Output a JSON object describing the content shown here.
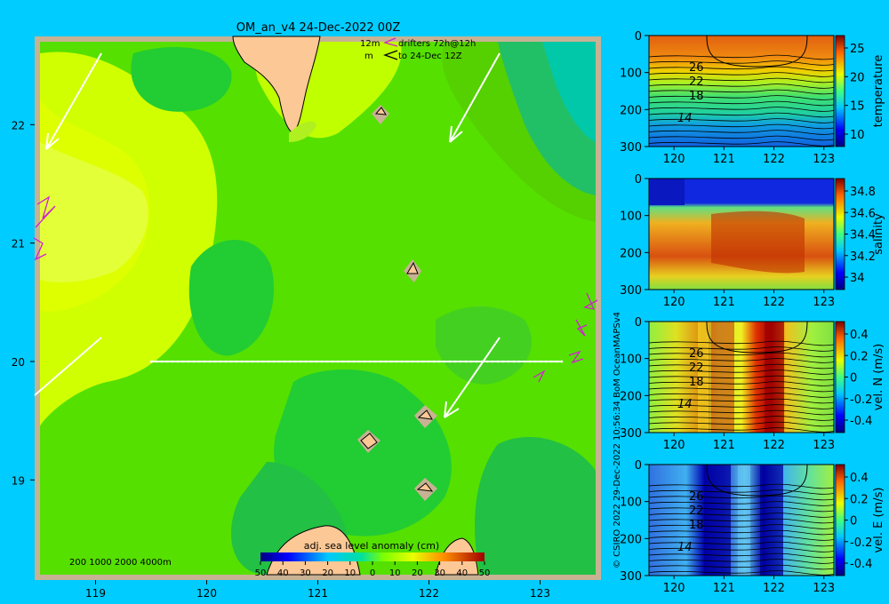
{
  "colors": {
    "background": "#00ccff",
    "frame": "#c8b294",
    "land": "#fcc896",
    "drifter": "#d020d0",
    "section_line": "#ffffff"
  },
  "chart_data": [
    {
      "type": "heatmap",
      "panel": "map",
      "title": "OM_an_v4  24-Dec-2022 00Z",
      "x_ticks": [
        "119",
        "120",
        "121",
        "122",
        "123"
      ],
      "y_ticks": [
        "22",
        "21",
        "20",
        "19"
      ],
      "xlim": [
        118.5,
        123.5
      ],
      "ylim": [
        18.2,
        22.7
      ],
      "legend": {
        "scale_label": "12m",
        "unit_label": "m",
        "drifters_label": "drifters 72h@12h",
        "drifters_date": "to 24-Dec 12Z"
      },
      "depth_legend": "200  1000  2000  4000m",
      "colorbar": {
        "label": "adj. sea level anomaly (cm)",
        "ticks": [
          "50",
          "40",
          "30",
          "20",
          "10",
          "0",
          "10",
          "20",
          "30",
          "40",
          "50"
        ],
        "range": [
          -50,
          50
        ]
      },
      "section_line": {
        "lon": [
          119.5,
          123.2
        ],
        "lat": [
          20.0,
          20.0
        ]
      },
      "current_arrows": [
        {
          "from": [
            118.9,
            22.55
          ],
          "to": [
            118.6,
            21.7
          ]
        },
        {
          "from": [
            122.6,
            22.55
          ],
          "to": [
            122.2,
            21.8
          ]
        },
        {
          "from": [
            119.1,
            20.2
          ],
          "to": [
            118.5,
            19.7
          ]
        },
        {
          "from": [
            122.6,
            20.2
          ],
          "to": [
            122.1,
            19.5
          ]
        }
      ]
    },
    {
      "type": "heatmap",
      "panel": "temperature",
      "x_ticks": [
        "120",
        "121",
        "122",
        "123"
      ],
      "y_ticks": [
        "0",
        "100",
        "200",
        "300"
      ],
      "colorbar_label": "temperature",
      "colorbar_ticks": [
        "25",
        "20",
        "15",
        "10"
      ],
      "contour_labels": [
        "26",
        "22",
        "18",
        "14"
      ]
    },
    {
      "type": "heatmap",
      "panel": "salinity",
      "x_ticks": [
        "120",
        "121",
        "122",
        "123"
      ],
      "y_ticks": [
        "0",
        "100",
        "200",
        "300"
      ],
      "colorbar_label": "salinity",
      "colorbar_ticks": [
        "34.8",
        "34.6",
        "34.4",
        "34.2",
        "34"
      ]
    },
    {
      "type": "heatmap",
      "panel": "vel_n",
      "x_ticks": [
        "120",
        "121",
        "122",
        "123"
      ],
      "y_ticks": [
        "0",
        "100",
        "200",
        "300"
      ],
      "colorbar_label": "vel. N (m/s)",
      "colorbar_ticks": [
        "0.4",
        "0.2",
        "0",
        "-0.2",
        "-0.4"
      ],
      "contour_labels": [
        "26",
        "22",
        "18",
        "14"
      ]
    },
    {
      "type": "heatmap",
      "panel": "vel_e",
      "x_ticks": [
        "120",
        "121",
        "122",
        "123"
      ],
      "y_ticks": [
        "0",
        "100",
        "200",
        "300"
      ],
      "colorbar_label": "vel. E (m/s)",
      "colorbar_ticks": [
        "0.4",
        "0.2",
        "0",
        "-0.2",
        "-0.4"
      ],
      "contour_labels": [
        "26",
        "22",
        "18",
        "14"
      ]
    }
  ],
  "credit": "© CSIRO 2022  29-Dec-2022 10:56:34 BoM OceanMAPSv4"
}
